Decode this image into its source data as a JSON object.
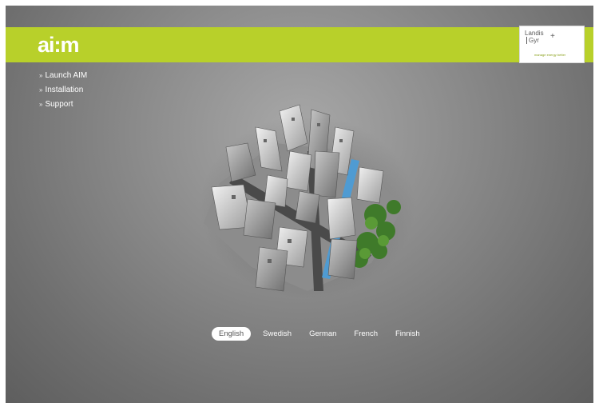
{
  "header": {
    "logo_text": "ai:m",
    "brand": {
      "line1": "Landis",
      "line2": "Gyr",
      "plus": "+",
      "tagline": "manage energy better"
    },
    "banner_color": "#b8d02a"
  },
  "menu": {
    "bullet": "»",
    "items": [
      {
        "label": "Launch AIM"
      },
      {
        "label": "Installation"
      },
      {
        "label": "Support"
      }
    ]
  },
  "languages": {
    "selected": "English",
    "items": [
      {
        "label": "English"
      },
      {
        "label": "Swedish"
      },
      {
        "label": "German"
      },
      {
        "label": "French"
      },
      {
        "label": "Finnish"
      }
    ]
  }
}
